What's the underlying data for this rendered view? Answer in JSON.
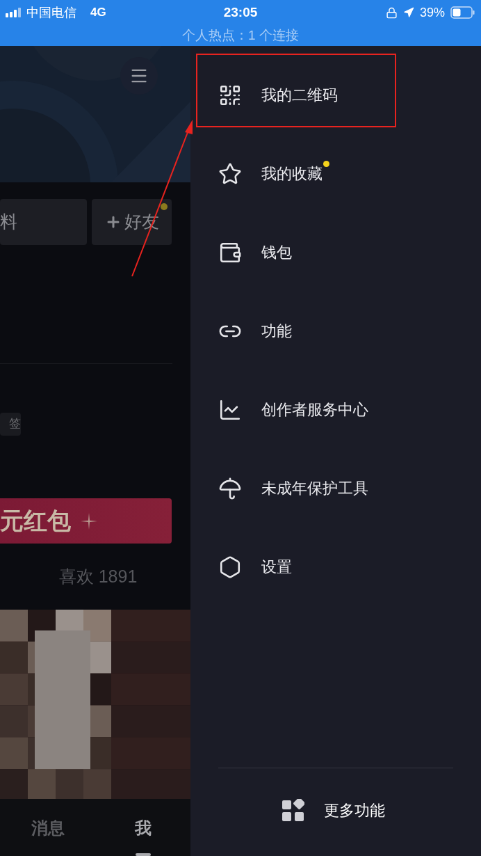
{
  "status_bar": {
    "carrier": "中国电信",
    "network": "4G",
    "time": "23:05",
    "battery": "39%",
    "hotspot": "个人热点：1 个连接"
  },
  "profile": {
    "buttons": [
      {
        "label": "料"
      },
      {
        "label": "好友",
        "badge": true
      }
    ],
    "tag": "签",
    "banner": "元红包",
    "likes": "喜欢 1891"
  },
  "tab_bar": [
    {
      "label": "消息",
      "selected": false
    },
    {
      "label": "我",
      "selected": true
    }
  ],
  "drawer": {
    "items": [
      {
        "label": "我的二维码",
        "badge": false,
        "highlighted": true
      },
      {
        "label": "我的收藏",
        "badge": true,
        "highlighted": false
      },
      {
        "label": "钱包",
        "badge": false,
        "highlighted": false
      },
      {
        "label": "功能",
        "badge": false,
        "highlighted": false
      },
      {
        "label": "创作者服务中心",
        "badge": false,
        "highlighted": false
      },
      {
        "label": "未成年保护工具",
        "badge": false,
        "highlighted": false
      },
      {
        "label": "设置",
        "badge": false,
        "highlighted": false
      }
    ],
    "more": "更多功能"
  }
}
